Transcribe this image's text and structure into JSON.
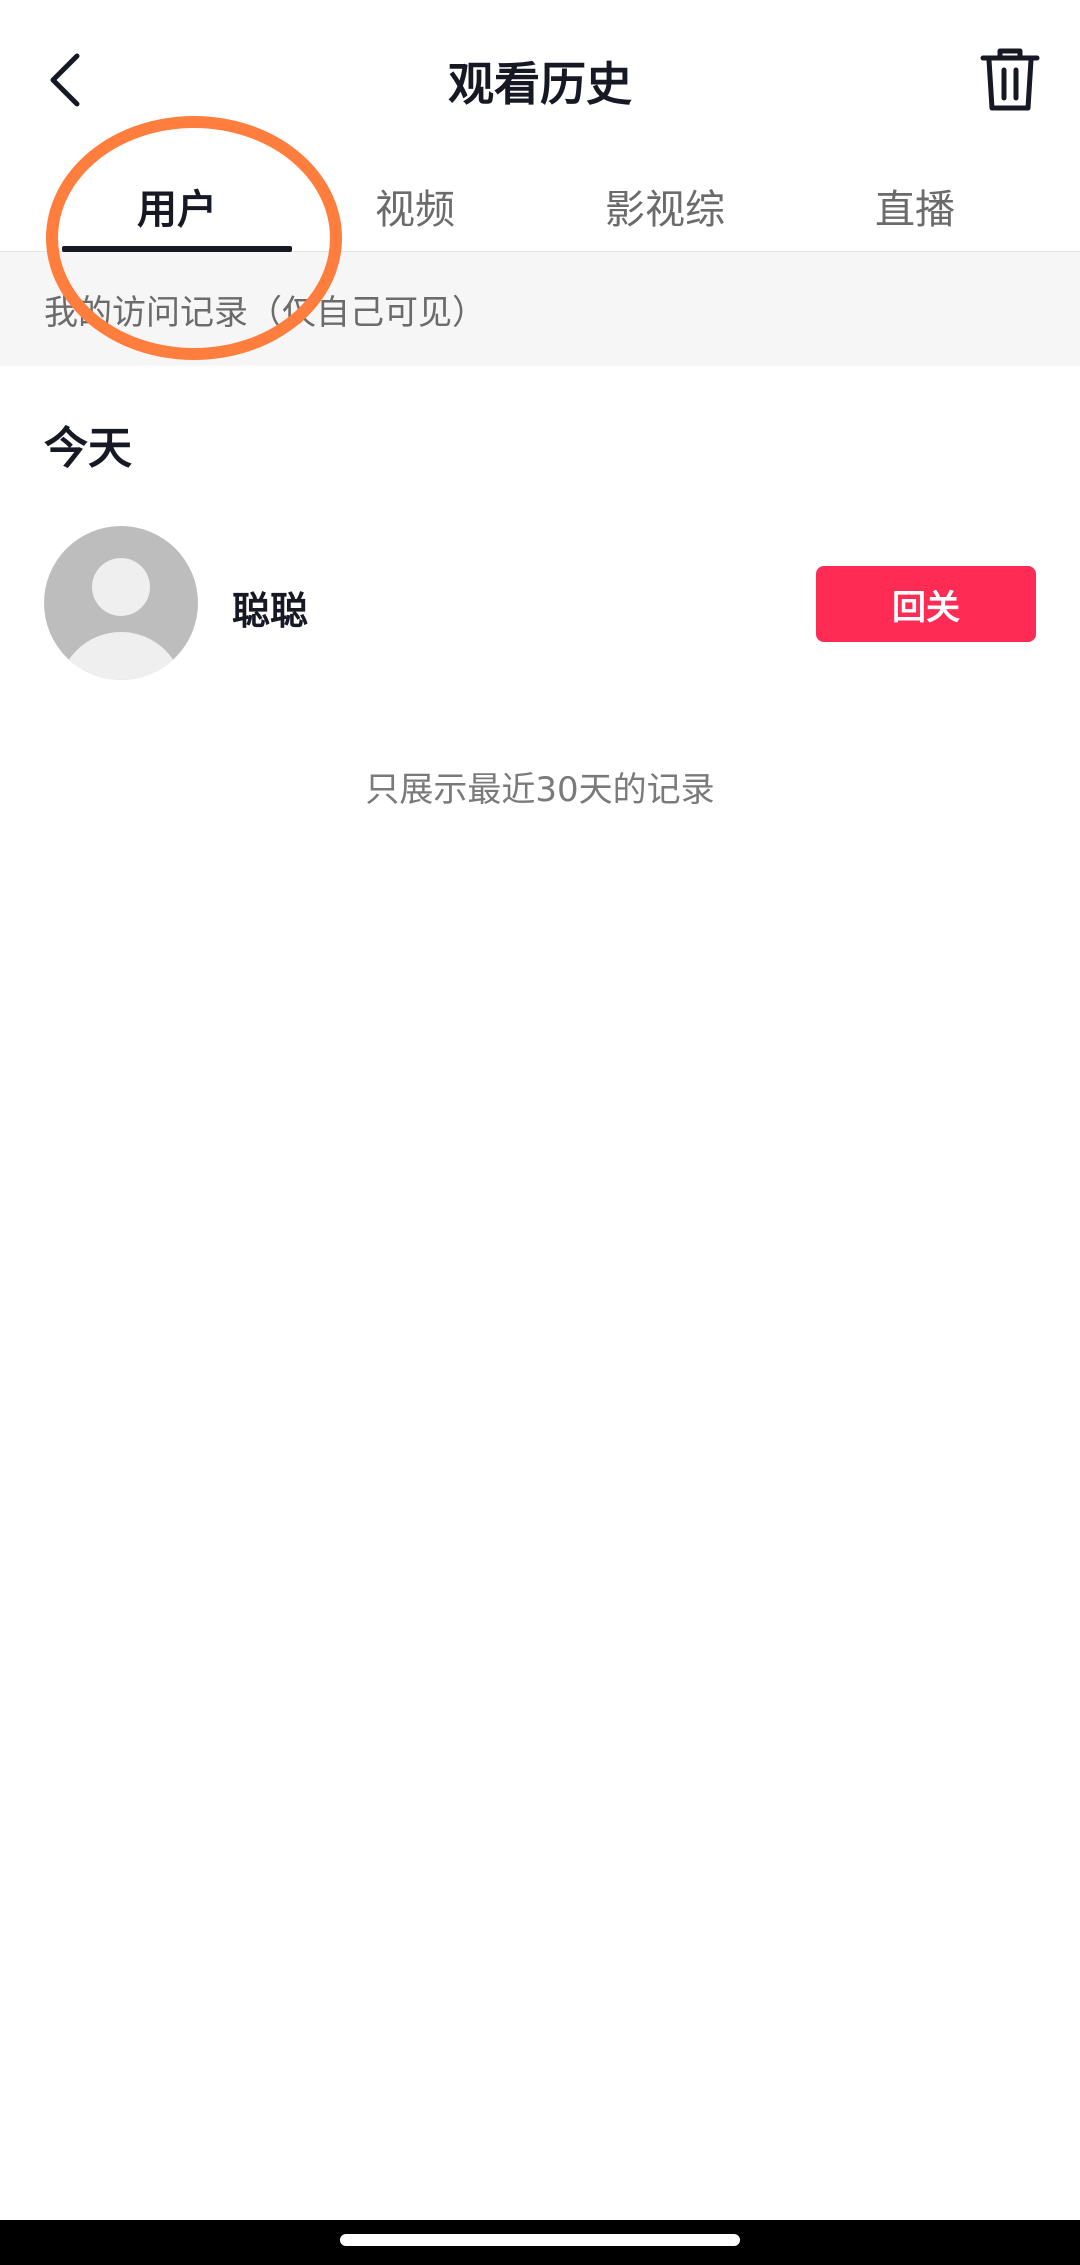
{
  "header": {
    "title": "观看历史",
    "back_icon": "chevron-left-icon",
    "delete_icon": "trash-icon"
  },
  "tabs": [
    {
      "label": "用户",
      "active": true
    },
    {
      "label": "视频",
      "active": false
    },
    {
      "label": "影视综",
      "active": false
    },
    {
      "label": "直播",
      "active": false
    }
  ],
  "banner": {
    "text": "我的访问记录（仅自己可见）"
  },
  "section": {
    "title": "今天"
  },
  "user": {
    "name": "聪聪",
    "action_label": "回关"
  },
  "footer_note": "只展示最近30天的记录",
  "colors": {
    "accent": "#fe2c55",
    "annotation": "#ff7e3e",
    "text_primary": "#161823",
    "text_secondary": "#6b6b6b",
    "banner_bg": "#f6f6f6"
  }
}
